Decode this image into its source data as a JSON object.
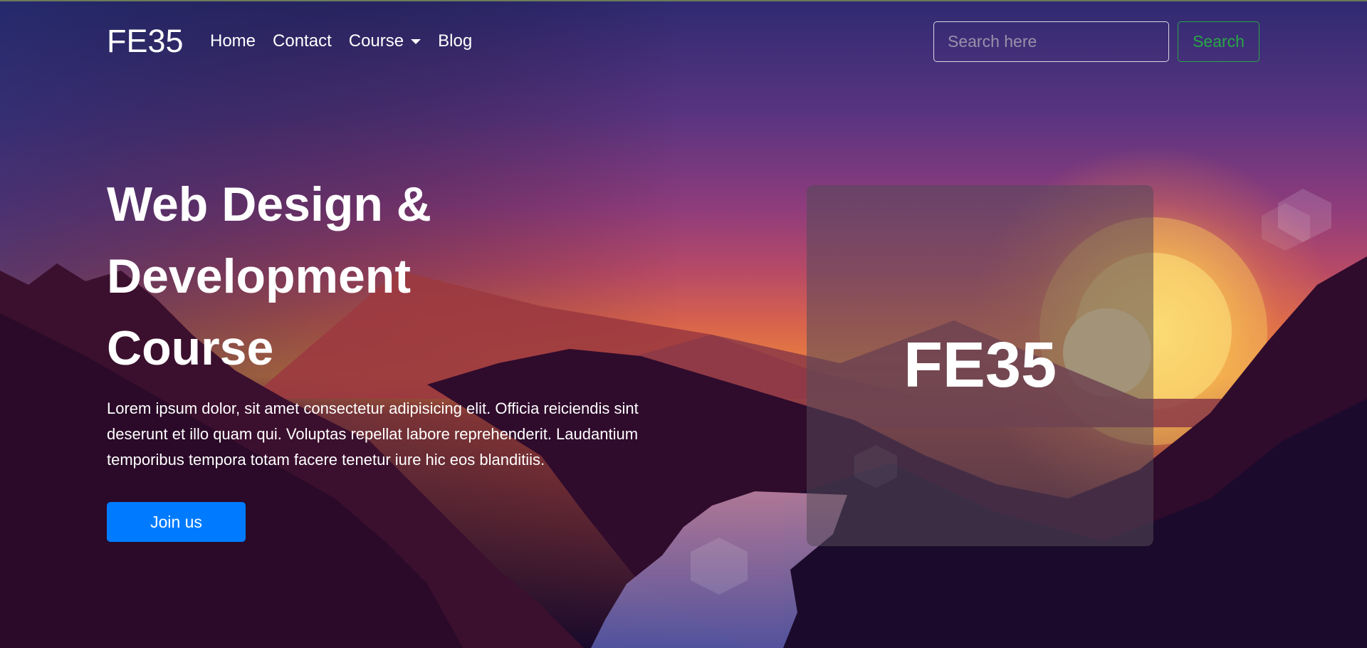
{
  "navbar": {
    "brand": "FE35",
    "links": [
      {
        "label": "Home"
      },
      {
        "label": "Contact"
      },
      {
        "label": "Course"
      },
      {
        "label": "Blog"
      }
    ],
    "search_placeholder": "Search here",
    "search_button": "Search"
  },
  "hero": {
    "title_line1": "Web Design &",
    "title_line2": "Development",
    "title_line3": "Course",
    "description": "Lorem ipsum dolor, sit amet consectetur adipisicing elit. Officia reiciendis sint deserunt et illo quam qui. Voluptas repellat labore reprehenderit. Laudantium temporibus tempora totam facere tenetur iure hic eos blanditiis.",
    "cta_label": "Join us"
  },
  "card": {
    "label": "FE35"
  },
  "colors": {
    "primary": "#007bff",
    "success": "#28a745",
    "text": "#ffffff"
  }
}
